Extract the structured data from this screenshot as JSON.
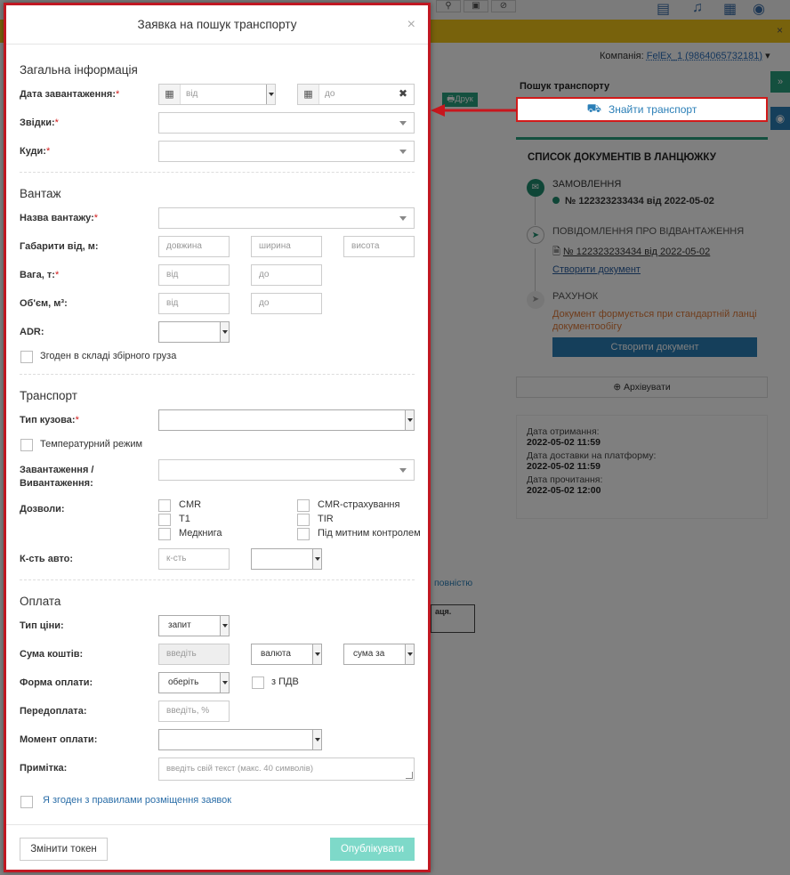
{
  "background": {
    "company_label": "Компанія:",
    "company_value": "FelEx_1 (9864065732181)",
    "print_label": "Друк",
    "search_panel_title": "Пошук транспорту",
    "find_transport_label": "Знайти транспорт",
    "chain": {
      "title": "СПИСОК ДОКУМЕНТІВ В ЛАНЦЮЖКУ",
      "steps": [
        {
          "name": "ЗАМОВЛЕННЯ",
          "doc": "№ 122323233434 від 2022-05-02"
        },
        {
          "name": "ПОВІДОМЛЕННЯ ПРО ВІДВАНТАЖЕННЯ",
          "doc": "№ 122323233434 від 2022-05-02",
          "action": "Створити документ"
        },
        {
          "name": "РАХУНОК",
          "note": "Документ формується при стандартній ланці документообігу",
          "action": "Створити документ"
        }
      ]
    },
    "archive_label": "Архівувати",
    "dates": [
      {
        "label": "Дата отримання:",
        "value": "2022-05-02 11:59"
      },
      {
        "label": "Дата доставки на платформу:",
        "value": "2022-05-02 11:59"
      },
      {
        "label": "Дата прочитання:",
        "value": "2022-05-02 12:00"
      }
    ],
    "snippet_link": "повністю",
    "snippet_header": "аця.",
    "side_button": "»"
  },
  "modal": {
    "title": "Заявка на пошук транспорту",
    "close": "×",
    "general": {
      "title": "Загальна інформація",
      "load_date_label": "Дата завантаження:",
      "date_from_placeholder": "від",
      "date_to_placeholder": "до",
      "from_label": "Звідки:",
      "to_label": "Куди:",
      "required_mark": "*"
    },
    "cargo": {
      "title": "Вантаж",
      "name_label": "Назва вантажу:",
      "dims_label": "Габарити від, м:",
      "length_placeholder": "довжина",
      "width_placeholder": "ширина",
      "height_placeholder": "висота",
      "weight_label": "Вага, т:",
      "volume_label": "Об'єм, м³:",
      "from_placeholder": "від",
      "to_placeholder": "до",
      "adr_label": "ADR:",
      "groupage_label": "Згоден в складі збірного груза"
    },
    "transport": {
      "title": "Транспорт",
      "body_type_label": "Тип кузова:",
      "temp_mode_label": "Температурний режим",
      "loading_label_1": "Завантаження /",
      "loading_label_2": "Вивантаження:",
      "permits_label": "Дозволи:",
      "permits": [
        "CMR",
        "CMR-страхування",
        "T1",
        "TIR",
        "Медкнига",
        "Під митним контролем"
      ],
      "count_label": "К-сть авто:",
      "count_placeholder": "к-сть"
    },
    "payment": {
      "title": "Оплата",
      "price_type_label": "Тип ціни:",
      "price_type_value": "запит",
      "amount_label": "Сума коштів:",
      "amount_placeholder": "введіть",
      "currency_value": "валюта",
      "sum_for_value": "сума за",
      "pay_form_label": "Форма оплати:",
      "pay_form_value": "оберіть",
      "vat_label": "з ПДВ",
      "prepay_label": "Передоплата:",
      "prepay_placeholder": "введіть, %",
      "pay_moment_label": "Момент оплати:",
      "note_label": "Примітка:",
      "note_placeholder": "введіть свій текст (макс. 40 символів)"
    },
    "agree_label": "Я згоден з правилами розміщення заявок",
    "change_token_label": "Змінити токен",
    "publish_label": "Опублікувати"
  },
  "colors": {
    "modal_border": "#c01822",
    "accent_green": "#28a17f",
    "accent_blue": "#2b7fb7",
    "publish_button": "#7ed9c9",
    "banner_yellow": "#f0c419"
  }
}
